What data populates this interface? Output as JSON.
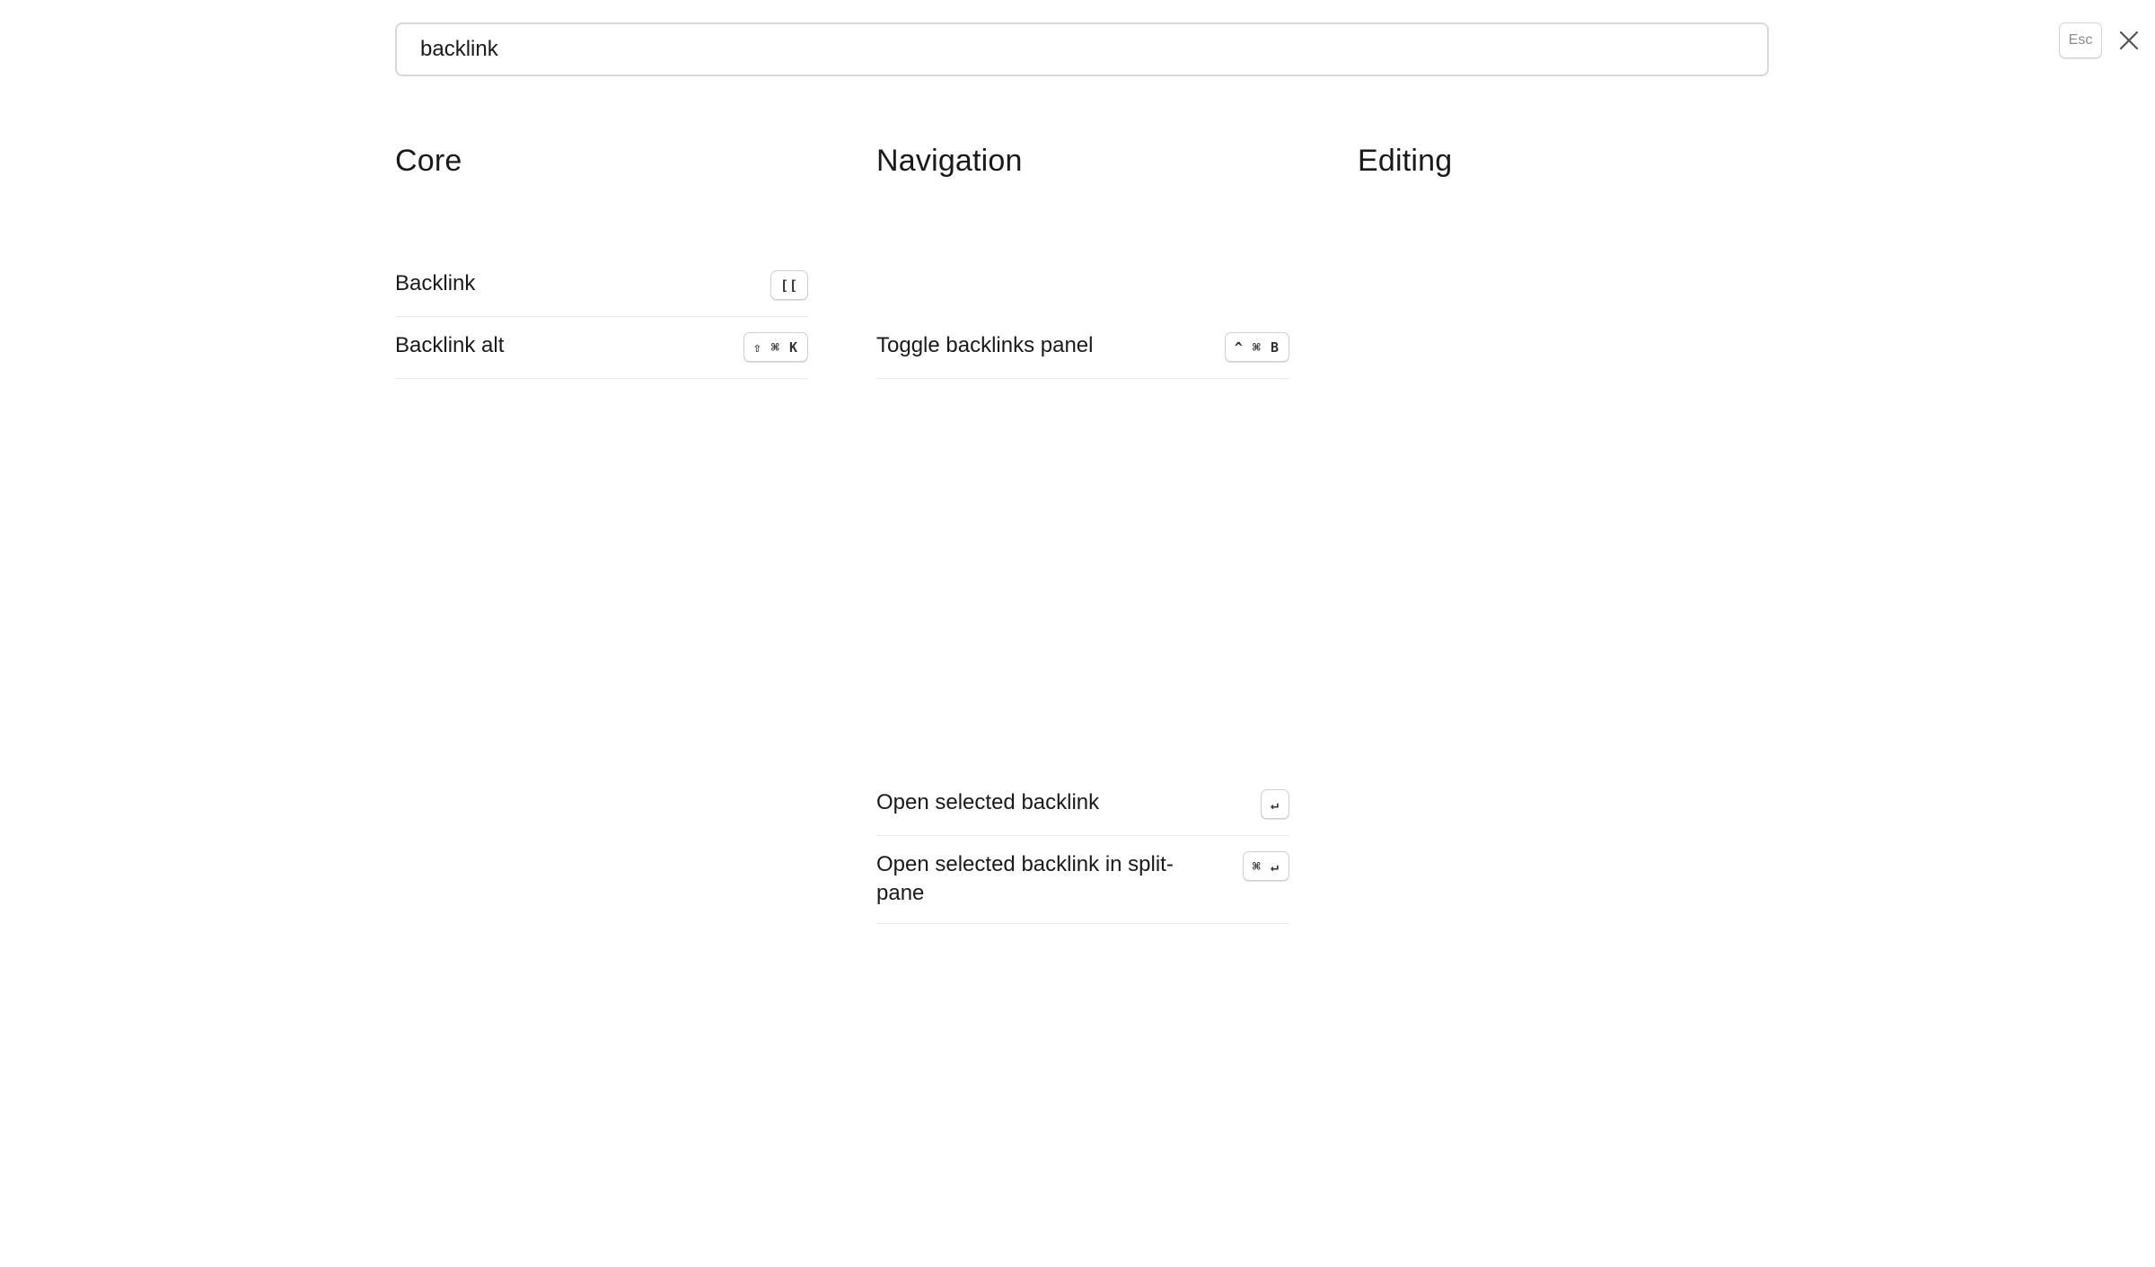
{
  "search": {
    "value": "backlink",
    "esc_label": "Esc"
  },
  "icons": {
    "close": "close-icon"
  },
  "columns": {
    "core": {
      "title": "Core",
      "rows": [
        {
          "label": "Backlink",
          "shortcut": "[["
        },
        {
          "label": "Backlink alt",
          "shortcut": "⇧ ⌘ K"
        }
      ]
    },
    "navigation": {
      "title": "Navigation",
      "rows": [
        {
          "label": "Toggle backlinks panel",
          "shortcut": "^ ⌘ B"
        },
        {
          "label": "Open selected backlink",
          "shortcut": "↵"
        },
        {
          "label": "Open selected backlink in split-pane",
          "shortcut": "⌘ ↵"
        }
      ]
    },
    "editing": {
      "title": "Editing"
    }
  }
}
